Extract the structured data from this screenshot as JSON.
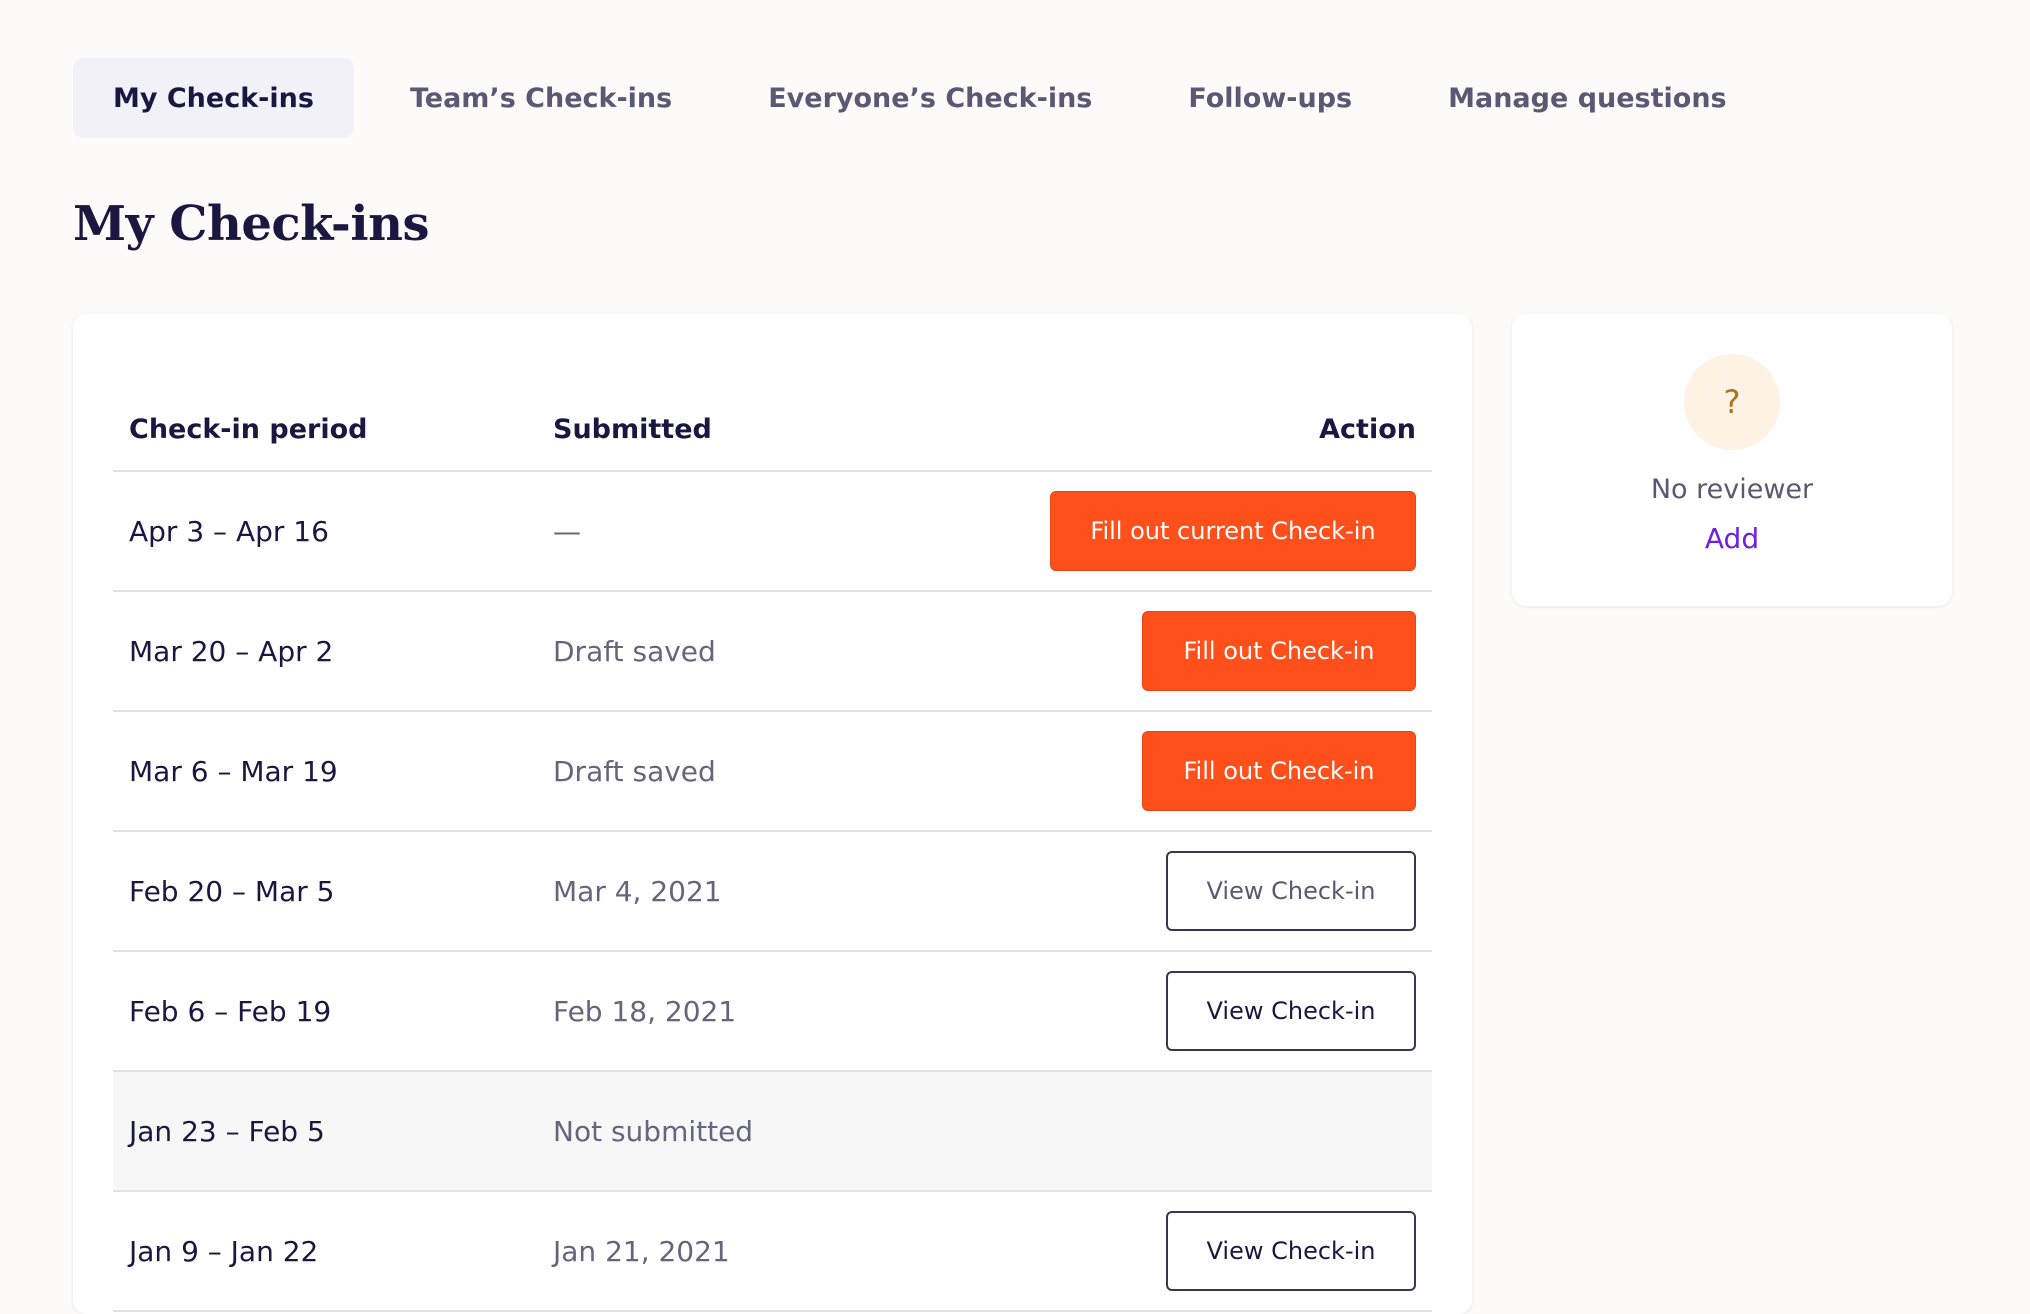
{
  "tabs": [
    {
      "label": "My Check-ins",
      "active": true
    },
    {
      "label": "Team’s Check-ins",
      "active": false
    },
    {
      "label": "Everyone’s Check-ins",
      "active": false
    },
    {
      "label": "Follow-ups",
      "active": false
    },
    {
      "label": "Manage questions",
      "active": false
    }
  ],
  "page": {
    "title": "My Check-ins"
  },
  "table": {
    "headers": {
      "period": "Check-in period",
      "submitted": "Submitted",
      "action": "Action"
    },
    "rows": [
      {
        "period": "Apr 3 – Apr 16",
        "submitted": "—",
        "action": "Fill out current Check-in"
      },
      {
        "period": "Mar 20 – Apr 2",
        "submitted": "Draft saved",
        "action": "Fill out Check-in"
      },
      {
        "period": "Mar 6 – Mar 19",
        "submitted": "Draft saved",
        "action": "Fill out Check-in"
      },
      {
        "period": "Feb 20 – Mar 5",
        "submitted": "Mar 4, 2021",
        "action": "View Check-in"
      },
      {
        "period": "Feb 6 – Feb 19",
        "submitted": "Feb 18, 2021",
        "action": "View Check-in"
      },
      {
        "period": "Jan 23 – Feb 5",
        "submitted": "Not submitted",
        "action": ""
      },
      {
        "period": "Jan 9 – Jan 22",
        "submitted": "Jan 21, 2021",
        "action": "View Check-in"
      }
    ]
  },
  "reviewer": {
    "avatar_glyph": "?",
    "status": "No reviewer",
    "add_label": "Add"
  },
  "colors": {
    "primary_button": "#ff4f1a",
    "link": "#6f1fe0",
    "background": "#fcfbfa",
    "text": "#1b1740"
  }
}
